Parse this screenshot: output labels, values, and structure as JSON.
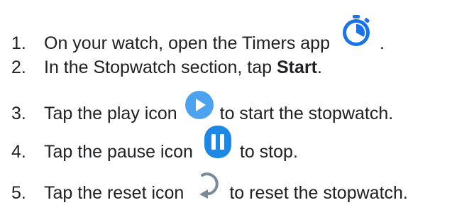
{
  "steps": [
    {
      "number": "1.",
      "text_before": "On your watch, open the Timers app",
      "text_after": ".",
      "icon": "timer-app-icon"
    },
    {
      "number": "2.",
      "text_before": "In the Stopwatch section, tap ",
      "bold": "Start",
      "text_after": "."
    },
    {
      "number": "3.",
      "text_before": "Tap the play icon",
      "text_after": "to start the stopwatch.",
      "icon": "play-icon"
    },
    {
      "number": "4.",
      "text_before": "Tap the pause icon",
      "text_after": "to stop.",
      "icon": "pause-icon"
    },
    {
      "number": "5.",
      "text_before": "Tap the reset icon",
      "text_after": "to reset the stopwatch.",
      "icon": "reset-icon"
    }
  ],
  "colors": {
    "text": "#202124",
    "timer_blue": "#1a73e8",
    "play_blue": "#4da3f0",
    "pause_blue": "#1e88e5",
    "reset_gray": "#7a8a96"
  }
}
